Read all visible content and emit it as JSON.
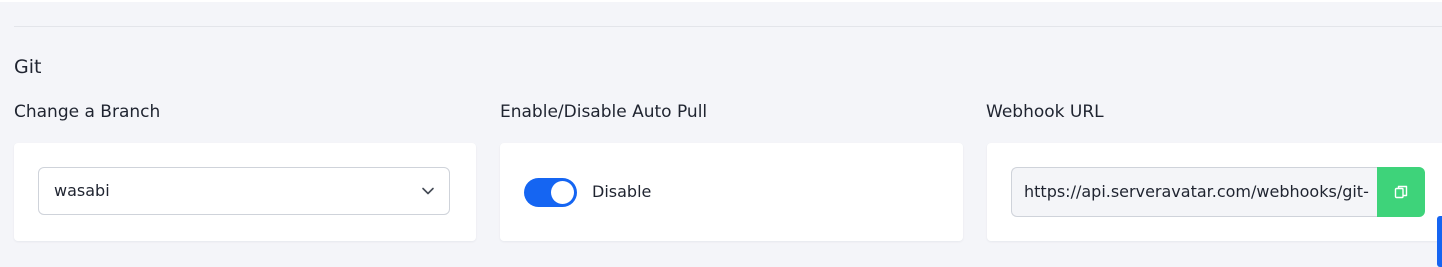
{
  "section": {
    "title": "Git"
  },
  "branch": {
    "label": "Change a Branch",
    "selected": "wasabi"
  },
  "auto_pull": {
    "label": "Enable/Disable Auto Pull",
    "toggle_on": true,
    "toggle_text": "Disable"
  },
  "webhook": {
    "label": "Webhook URL",
    "url": "https://api.serveravatar.com/webhooks/git-"
  },
  "colors": {
    "toggle_accent": "#1565f2",
    "copy_button": "#3ed37a"
  },
  "icons": {
    "dropdown": "chevron-down-icon",
    "copy": "copy-icon"
  }
}
